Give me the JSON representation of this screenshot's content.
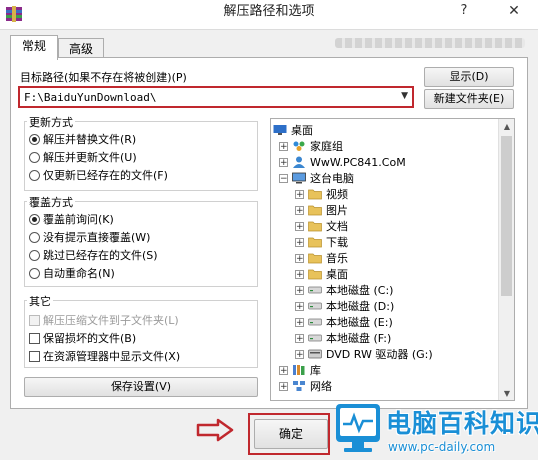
{
  "window": {
    "title": "解压路径和选项",
    "help": "?",
    "close": "✕"
  },
  "tabs": [
    {
      "label": "常规"
    },
    {
      "label": "高级"
    }
  ],
  "target": {
    "label": "目标路径(如果不存在将被创建)(P)",
    "value": "F:\\BaiduYunDownload\\",
    "show_button": "显示(D)",
    "new_folder_button": "新建文件夹(E)"
  },
  "update_mode": {
    "title": "更新方式",
    "options": [
      {
        "label": "解压并替换文件(R)",
        "selected": true
      },
      {
        "label": "解压并更新文件(U)",
        "selected": false
      },
      {
        "label": "仅更新已经存在的文件(F)",
        "selected": false
      }
    ]
  },
  "overwrite_mode": {
    "title": "覆盖方式",
    "options": [
      {
        "label": "覆盖前询问(K)",
        "selected": true
      },
      {
        "label": "没有提示直接覆盖(W)",
        "selected": false
      },
      {
        "label": "跳过已经存在的文件(S)",
        "selected": false
      },
      {
        "label": "自动重命名(N)",
        "selected": false
      }
    ]
  },
  "misc": {
    "title": "其它",
    "options": [
      {
        "label": "解压压缩文件到子文件夹(L)",
        "checked": false,
        "disabled": true
      },
      {
        "label": "保留损坏的文件(B)",
        "checked": false,
        "disabled": false
      },
      {
        "label": "在资源管理器中显示文件(X)",
        "checked": false,
        "disabled": false
      }
    ]
  },
  "save_settings_button": "保存设置(V)",
  "tree": {
    "items": [
      {
        "label": "桌面",
        "icon": "desktop-icon",
        "level": 0,
        "expander": ""
      },
      {
        "label": "家庭组",
        "icon": "homegroup-icon",
        "level": 1,
        "expander": "+"
      },
      {
        "label": "WwW.PC841.CoM",
        "icon": "user-icon",
        "level": 1,
        "expander": "+"
      },
      {
        "label": "这台电脑",
        "icon": "computer-icon",
        "level": 1,
        "expander": "−"
      },
      {
        "label": "视频",
        "icon": "folder-icon",
        "level": 2,
        "expander": "+"
      },
      {
        "label": "图片",
        "icon": "folder-icon",
        "level": 2,
        "expander": "+"
      },
      {
        "label": "文档",
        "icon": "folder-icon",
        "level": 2,
        "expander": "+"
      },
      {
        "label": "下载",
        "icon": "folder-icon",
        "level": 2,
        "expander": "+"
      },
      {
        "label": "音乐",
        "icon": "folder-icon",
        "level": 2,
        "expander": "+"
      },
      {
        "label": "桌面",
        "icon": "folder-icon",
        "level": 2,
        "expander": "+"
      },
      {
        "label": "本地磁盘 (C:)",
        "icon": "drive-icon",
        "level": 2,
        "expander": "+"
      },
      {
        "label": "本地磁盘 (D:)",
        "icon": "drive-icon",
        "level": 2,
        "expander": "+"
      },
      {
        "label": "本地磁盘 (E:)",
        "icon": "drive-icon",
        "level": 2,
        "expander": "+"
      },
      {
        "label": "本地磁盘 (F:)",
        "icon": "drive-icon",
        "level": 2,
        "expander": "+"
      },
      {
        "label": "DVD RW 驱动器 (G:)",
        "icon": "dvd-icon",
        "level": 2,
        "expander": "+"
      },
      {
        "label": "库",
        "icon": "library-icon",
        "level": 1,
        "expander": "+"
      },
      {
        "label": "网络",
        "icon": "network-icon",
        "level": 1,
        "expander": "+"
      }
    ]
  },
  "ok_button": "确定",
  "logo": {
    "text": "电脑百科知识",
    "url": "www.pc-daily.com"
  },
  "colors": {
    "highlight": "#c0282e",
    "logo_blue": "#1a8fd6",
    "folder": "#e8c25a"
  }
}
